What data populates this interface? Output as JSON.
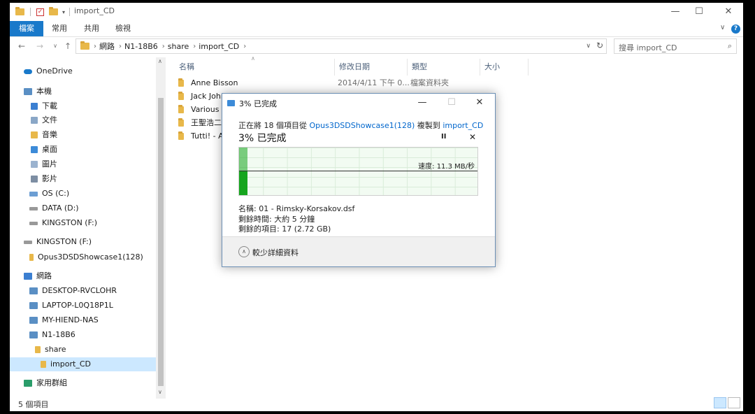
{
  "window": {
    "title": "import_CD",
    "controls": [
      "—",
      "☐",
      "✕"
    ]
  },
  "ribbon": {
    "tabs": [
      "檔案",
      "常用",
      "共用",
      "檢視"
    ]
  },
  "address": {
    "crumbs": [
      "網路",
      "N1-18B6",
      "share",
      "import_CD"
    ],
    "search_placeholder": "搜尋 import_CD"
  },
  "sidebar": {
    "items": [
      {
        "label": "OneDrive",
        "icon": "cloud-icon",
        "color": "#1979ca"
      },
      {
        "label": "本機",
        "icon": "computer-icon",
        "color": "#5a8fc4"
      },
      {
        "label": "下載",
        "icon": "download-folder-icon",
        "color": "#3b7fd1"
      },
      {
        "label": "文件",
        "icon": "documents-folder-icon",
        "color": "#8aa7c7"
      },
      {
        "label": "音樂",
        "icon": "music-folder-icon",
        "color": "#e8b84a"
      },
      {
        "label": "桌面",
        "icon": "desktop-folder-icon",
        "color": "#3c8bd8"
      },
      {
        "label": "圖片",
        "icon": "pictures-folder-icon",
        "color": "#9bb3cf"
      },
      {
        "label": "影片",
        "icon": "videos-folder-icon",
        "color": "#7d8ea3"
      },
      {
        "label": "OS (C:)",
        "icon": "windows-drive-icon",
        "color": "#6c9ed3"
      },
      {
        "label": "DATA (D:)",
        "icon": "drive-icon",
        "color": "#999999"
      },
      {
        "label": "KINGSTON (F:)",
        "icon": "usb-drive-icon",
        "color": "#999999"
      },
      {
        "label": "KINGSTON (F:)",
        "icon": "usb-drive-icon",
        "color": "#999999"
      },
      {
        "label": "Opus3DSDShowcase1(128)",
        "icon": "folder-icon",
        "color": "#e8b84a"
      },
      {
        "label": "網路",
        "icon": "network-icon",
        "color": "#3b7fd1"
      },
      {
        "label": "DESKTOP-RVCLOHR",
        "icon": "computer-icon",
        "color": "#5a8fc4"
      },
      {
        "label": "LAPTOP-L0Q18P1L",
        "icon": "computer-icon",
        "color": "#5a8fc4"
      },
      {
        "label": "MY-HIEND-NAS",
        "icon": "computer-icon",
        "color": "#5a8fc4"
      },
      {
        "label": "N1-18B6",
        "icon": "computer-icon",
        "color": "#5a8fc4"
      },
      {
        "label": "share",
        "icon": "shared-folder-icon",
        "color": "#e8b84a"
      },
      {
        "label": "import_CD",
        "icon": "folder-icon",
        "color": "#e8b84a"
      },
      {
        "label": "家用群組",
        "icon": "homegroup-icon",
        "color": "#2a9d6a"
      }
    ]
  },
  "columns": [
    "名稱",
    "修改日期",
    "類型",
    "大小"
  ],
  "files": [
    {
      "name": "Anne Bisson",
      "date": "2014/4/11 下午 0...",
      "type": "檔案資料夾"
    },
    {
      "name": "Jack John",
      "date": "",
      "type": ""
    },
    {
      "name": "Various (",
      "date": "",
      "type": ""
    },
    {
      "name": "王聖浩二",
      "date": "",
      "type": ""
    },
    {
      "name": "Tutti! - A",
      "date": "",
      "type": ""
    }
  ],
  "status": {
    "count": "5 個項目"
  },
  "copy_dialog": {
    "title": "3% 已完成",
    "line_prefix": "正在將 18 個項目從 ",
    "source": "Opus3DSDShowcase1(128)",
    "line_mid": " 複製到 ",
    "dest": "import_CD",
    "percent_label": "3% 已完成",
    "progress": 0.03,
    "speed": "速度: 11.3 MB/秒",
    "name_line": "名稱: 01 - Rimsky-Korsakov.dsf",
    "time_line": "剩餘時間: 大約 5 分鐘",
    "items_line": "剩餘的項目: 17 (2.72 GB)",
    "less_details": "較少詳細資料",
    "pause": "II",
    "cancel": "✕",
    "fill_color": "#16a51e"
  }
}
